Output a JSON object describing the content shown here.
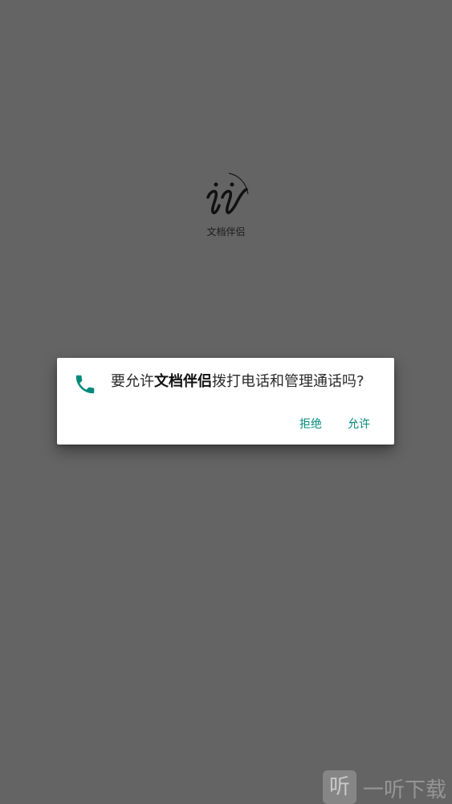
{
  "app": {
    "name": "文档伴侣"
  },
  "permission_dialog": {
    "message_prefix": "要允许",
    "app_name": "文档伴侣",
    "message_suffix": "拨打电话和管理通话吗?",
    "icon": "phone-icon",
    "deny_label": "拒绝",
    "allow_label": "允许",
    "accent_color": "#00897b"
  },
  "watermark": {
    "badge": "听",
    "text": "一听下载"
  },
  "colors": {
    "scrim": "#646464",
    "dialog_bg": "#ffffff"
  }
}
